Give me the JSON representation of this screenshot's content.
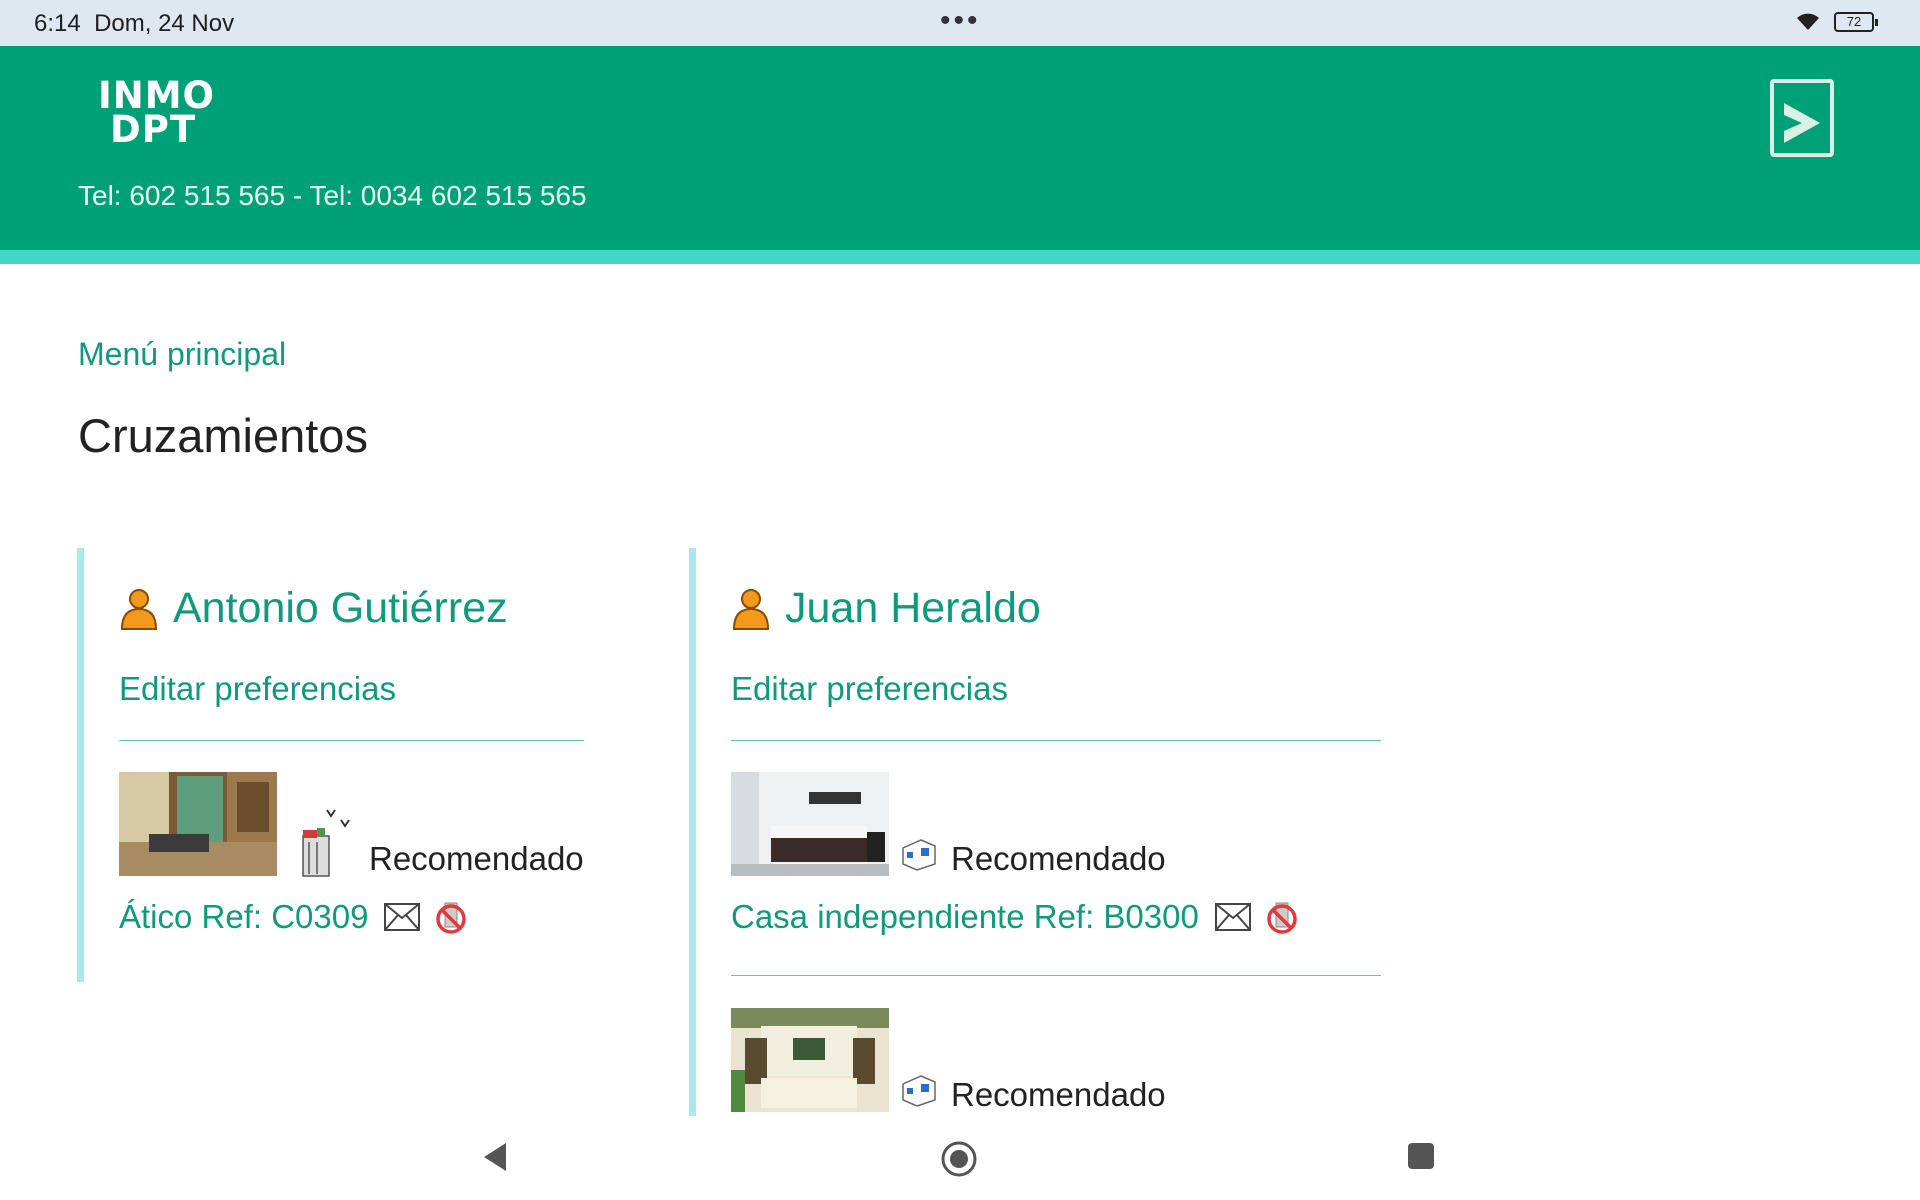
{
  "status_bar": {
    "time": "6:14",
    "date": "Dom, 24 Nov",
    "battery": "72"
  },
  "header": {
    "logo_line1": "INMO",
    "logo_line2": "DPT",
    "phones": "Tel: 602 515 565 - Tel: 0034 602 515 565"
  },
  "breadcrumb": "Menú principal",
  "page_title": "Cruzamientos",
  "clients": [
    {
      "name": "Antonio Gutiérrez",
      "edit_label": "Editar preferencias",
      "properties": [
        {
          "status": "Recomendado",
          "ref": "Ático Ref: C0309",
          "type_icon": "penthouse-icon"
        }
      ]
    },
    {
      "name": "Juan Heraldo",
      "edit_label": "Editar preferencias",
      "properties": [
        {
          "status": "Recomendado",
          "ref": "Casa independiente Ref: B0300",
          "type_icon": "house-icon"
        },
        {
          "status": "Recomendado",
          "ref": "",
          "type_icon": "house-icon"
        }
      ]
    }
  ],
  "colors": {
    "brand": "#00a077",
    "stripe": "#41d8c8",
    "link": "#0f9a7c",
    "card_border": "#ace8eb"
  }
}
